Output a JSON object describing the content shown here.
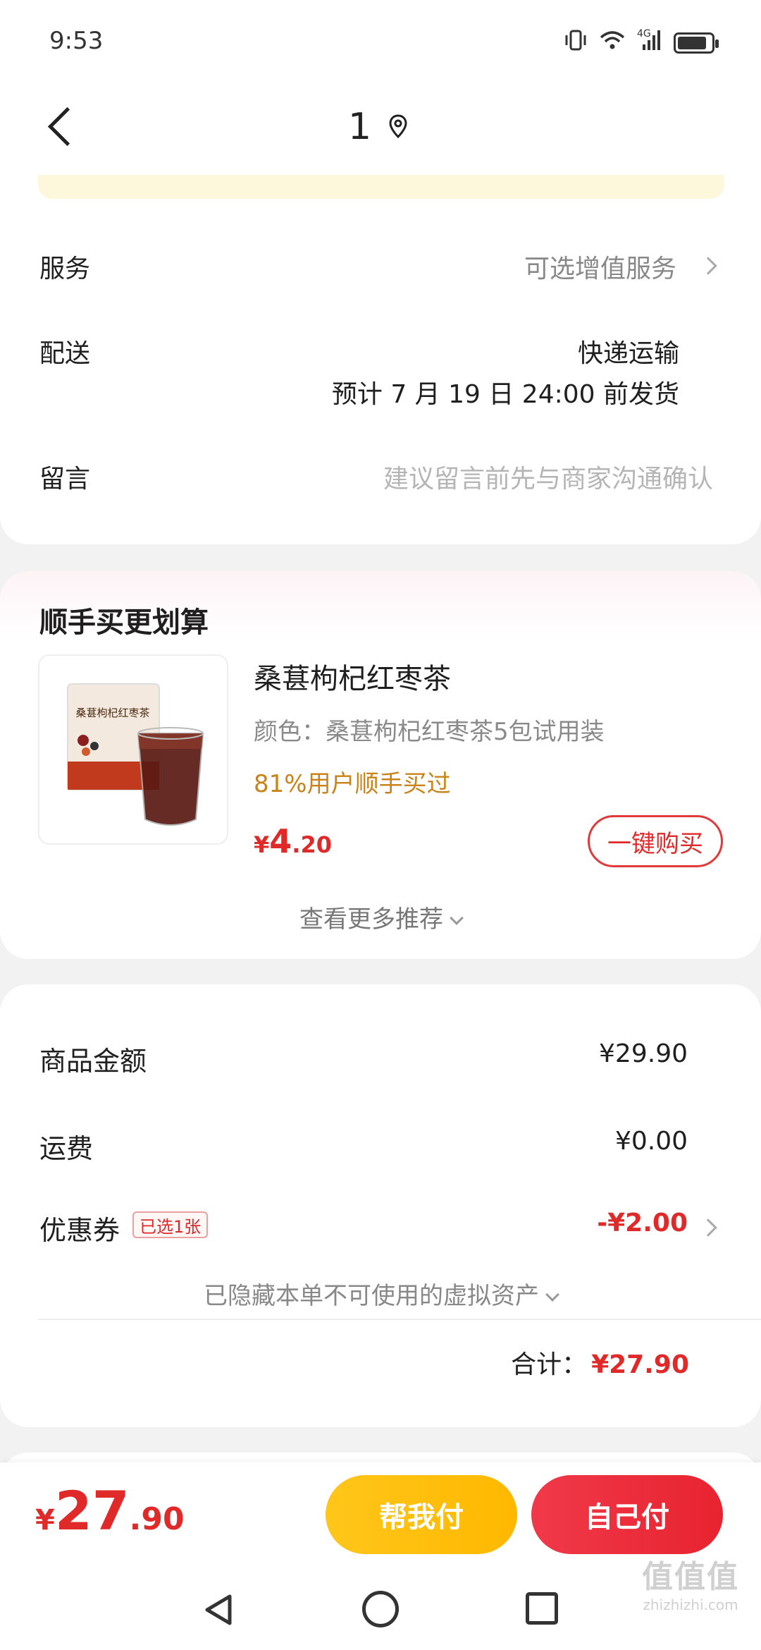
{
  "status_bar": {
    "time": "9:53",
    "network": "4G"
  },
  "nav": {
    "title": "1"
  },
  "order": {
    "service": {
      "label": "服务",
      "value": "可选增值服务"
    },
    "delivery": {
      "label": "配送",
      "method": "快递运输",
      "eta": "预计 7 月 19 日 24:00 前发货"
    },
    "message": {
      "label": "留言",
      "placeholder": "建议留言前先与商家沟通确认"
    }
  },
  "recommend": {
    "title": "顺手买更划算",
    "product": {
      "name": "桑葚枸杞红枣茶",
      "spec": "颜色：桑葚枸杞红枣茶5包试用装",
      "social_proof": "81%用户顺手买过",
      "price_symbol": "¥",
      "price_int": "4",
      "price_dec": ".20",
      "buy_label": "一键购买",
      "package_text": "桑葚枸杞红枣茶"
    },
    "more_label": "查看更多推荐"
  },
  "summary": {
    "goods": {
      "label": "商品金额",
      "value": "¥29.90"
    },
    "shipping": {
      "label": "运费",
      "value": "¥0.00"
    },
    "coupon": {
      "label": "优惠券",
      "badge": "已选1张",
      "value": "-¥2.00"
    },
    "hidden_assets": "已隐藏本单不可使用的虚拟资产",
    "total_label": "合计：",
    "total_value": "¥27.90"
  },
  "bottom": {
    "price_symbol": "¥",
    "price_int": "27",
    "price_dec": ".90",
    "help_pay": "帮我付",
    "self_pay": "自己付"
  },
  "watermark": {
    "top": "值值值",
    "bottom": "zhizhizhi.com"
  },
  "colors": {
    "accent_red": "#e02a2a",
    "accent_yellow": "#ffc61a",
    "social_gold": "#c98318"
  }
}
